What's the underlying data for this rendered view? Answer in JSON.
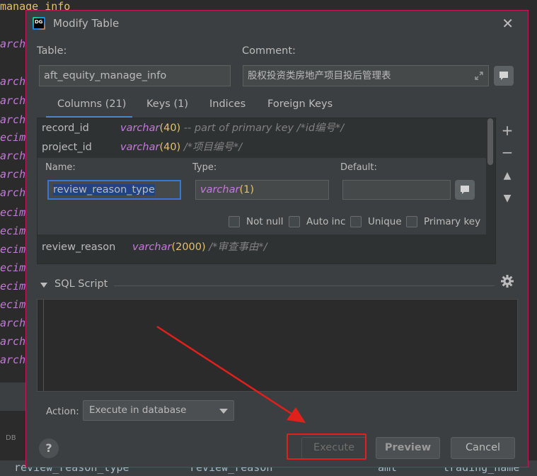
{
  "background": {
    "top_text": "manage_info",
    "left_fragments": [
      "arch",
      "arch",
      "arch",
      "arch",
      "ecim",
      "arch",
      "arch",
      "arch",
      "ecim",
      "ecim",
      "ecim",
      "ecim",
      "ecim",
      "ecim",
      "arch",
      "arch",
      "arch"
    ],
    "status_items": [
      "review_reason_type",
      "review_reason",
      "amt",
      "trading_name"
    ],
    "db_tag": "DB"
  },
  "dialog": {
    "title": "Modify Table",
    "close_label": "✕",
    "table_label": "Table:",
    "table_value": "aft_equity_manage_info",
    "comment_label": "Comment:",
    "comment_value": "股权投资类房地产项目投后管理表",
    "tabs": [
      {
        "label": "Columns (21)",
        "active": true
      },
      {
        "label": "Keys (1)",
        "active": false
      },
      {
        "label": "Indices",
        "active": false
      },
      {
        "label": "Foreign Keys",
        "active": false
      }
    ],
    "columns": [
      {
        "name": "record_id",
        "type": "varchar",
        "len": "(40)",
        "comment": " -- part of primary key /*id编号*/"
      },
      {
        "name": "project_id",
        "type": "varchar",
        "len": "(40)",
        "comment": " /*项目编号*/"
      },
      {
        "name": "review_reason",
        "type": "varchar",
        "len": "(2000)",
        "comment": " /*审查事由*/"
      }
    ],
    "editor": {
      "name_label": "Name:",
      "name_value": "review_reason_type",
      "type_label": "Type:",
      "type_name": "varchar",
      "type_len": "(1)",
      "default_label": "Default:",
      "default_value": "",
      "checkboxes": [
        "Not null",
        "Auto inc",
        "Unique",
        "Primary key"
      ]
    },
    "side_tools": [
      "+",
      "−",
      "▲",
      "▼"
    ],
    "sql_header": "SQL Script",
    "sql_text": "",
    "action_label": "Action:",
    "action_value": "Execute in database",
    "help_label": "?",
    "buttons": {
      "execute": "Execute",
      "preview": "Preview",
      "cancel": "Cancel"
    }
  },
  "colors": {
    "accent": "#4a88c7",
    "highlight": "#e0201b",
    "keyword": "#c678dd",
    "number": "#e8bf6a"
  }
}
